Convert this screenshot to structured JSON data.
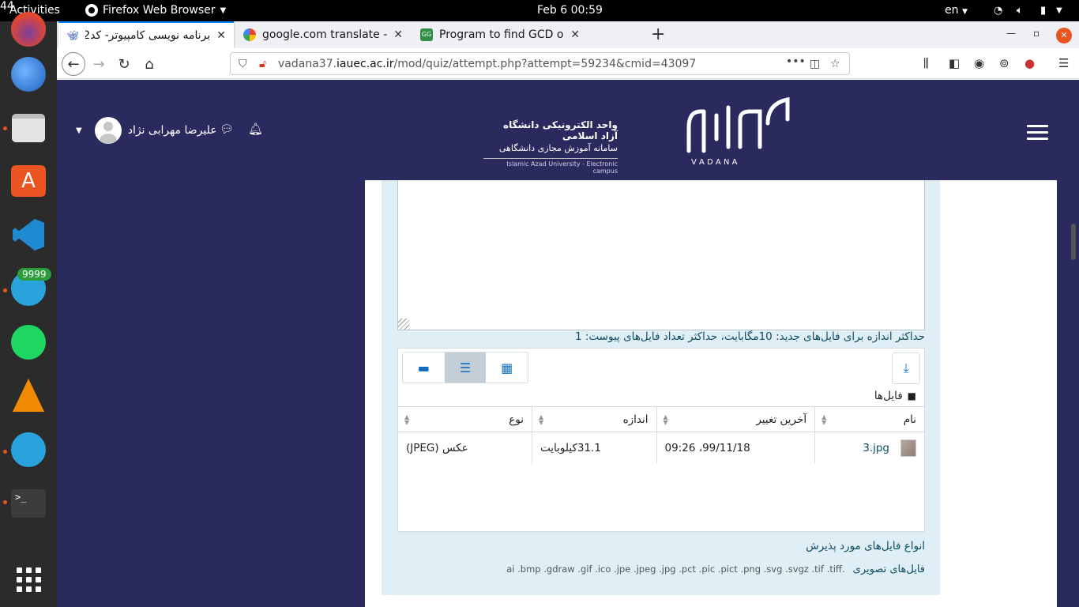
{
  "topbar": {
    "activities": "Activities",
    "app_menu": "Firefox Web Browser",
    "clock": "Feb 6  00:59",
    "notif_badge": "44",
    "lang": "en"
  },
  "dock": {
    "telegram_badge": "9999",
    "apps": [
      "firefox-icon",
      "thunderbird-icon",
      "files-icon",
      "software-center-icon",
      "vscode-icon",
      "telegram-icon",
      "spotify-icon",
      "vlc-icon",
      "telegram-desktop-icon",
      "terminal-icon",
      "show-apps-icon"
    ]
  },
  "tabs": [
    {
      "title": "برنامه نویسی کامپیوتر- کد2",
      "active": true
    },
    {
      "title": "google.com translate - ی",
      "active": false
    },
    {
      "title": "Program to find GCD or H",
      "active": false
    }
  ],
  "urlbar": {
    "prefix": "vadana37.",
    "host": "iauec.ac.ir",
    "path": "/mod/quiz/attempt.php?attempt=59234&cmid=43097"
  },
  "header": {
    "user_name": "علیرضا مهرابی نژاد",
    "logo_line1": "واحد الکترونیکی دانشگاه آزاد اسلامی",
    "logo_line2": "سامانه آموزش مجازی دانشگاهی",
    "logo_line3": "Islamic Azad University - Electronic campus",
    "brand_latin": "V A D A N A"
  },
  "upload": {
    "max_note": "حداکثر اندازه برای فایل‌های جدید: 10مگابایت، حداکثر تعداد فایل‌های پیوست: 1",
    "path_label": "فایل‌ها",
    "columns": {
      "name": "نام",
      "modified": "آخرین تغییر",
      "size": "اندازه",
      "type": "نوع"
    },
    "files": [
      {
        "name": "3.jpg",
        "modified": "99/11/18، 09:26",
        "size": "31.1کیلوبایت",
        "type": "عکس (JPEG)"
      }
    ],
    "accepted_title": "انواع فایل‌های مورد پذیرش",
    "accepted_group": "فایل‌های تصویری",
    "accepted_exts": ".ai .bmp .gdraw .gif .ico .jpe .jpeg .jpg .pct .pic .pict .png .svg .svgz .tif .tiff"
  },
  "colors": {
    "header_bg": "#2b2a5f",
    "question_bg": "#dfeff5",
    "accent": "#0f6cbf",
    "ubuntu_orange": "#e95420"
  }
}
